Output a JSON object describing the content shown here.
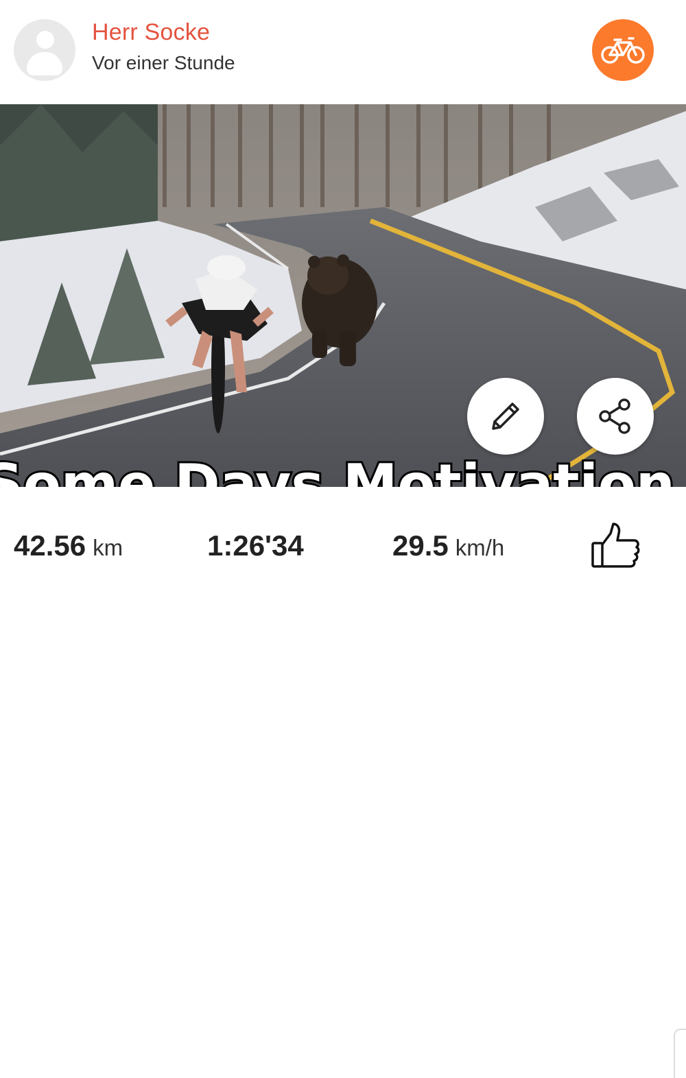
{
  "header": {
    "user_name": "Herr Socke",
    "time_ago": "Vor einer Stunde",
    "avatar_icon": "user-placeholder-icon",
    "activity_icon": "bicycle-icon",
    "accent_color": "#e4533f",
    "badge_color": "#fb7a2c"
  },
  "photo": {
    "overlay_text": "Some Days Motivation",
    "actions": [
      {
        "name": "edit",
        "icon": "pencil-icon"
      },
      {
        "name": "share",
        "icon": "share-icon"
      }
    ]
  },
  "stats": {
    "distance_value": "42.56",
    "distance_unit": "km",
    "duration_value": "1:26'34",
    "speed_value": "29.5",
    "speed_unit": "km/h",
    "like_icon": "thumbs-up-icon"
  }
}
